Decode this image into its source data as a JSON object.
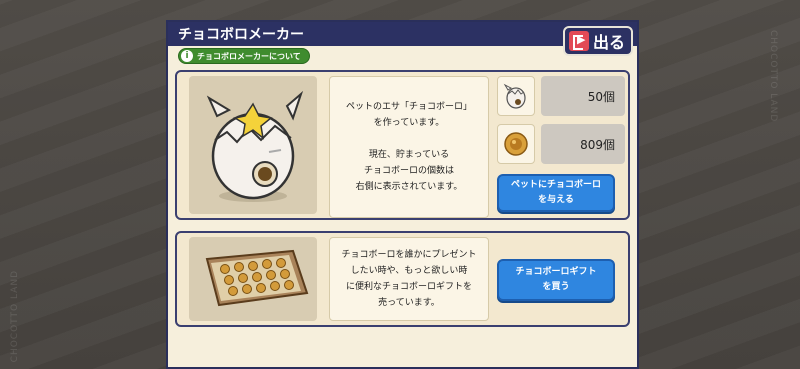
{
  "side_marks": {
    "right": "CHOCOTTO LAND",
    "left": "CHOCOTTO LAND"
  },
  "dialog": {
    "title": "チョコボロメーカー",
    "info_link": "チョコボロメーカーについて",
    "info_icon": "i",
    "exit_label": "出る"
  },
  "maker": {
    "description": "ペットのエサ「チョコボーロ」\nを作っています。\n\n現在、貯まっている\nチョコボーロの個数は\n右側に表示されています。",
    "counts": [
      {
        "icon": "egg-icon",
        "value": "50個"
      },
      {
        "icon": "chocoboro-coin-icon",
        "value": "809個"
      }
    ],
    "feed_button": "ペットにチョコボーロ\nを与える"
  },
  "gift": {
    "description": "チョコボーロを誰かにプレゼント\nしたい時や、もっと欲しい時\nに便利なチョコボーロギフトを\n売っています。",
    "buy_button": "チョコボーロギフト\nを買う"
  },
  "colors": {
    "header": "#2c3163",
    "panel_border": "#3a3f70",
    "button": "#2f86e0",
    "info_green": "#3f8c2e",
    "exit_red": "#e24a56"
  }
}
